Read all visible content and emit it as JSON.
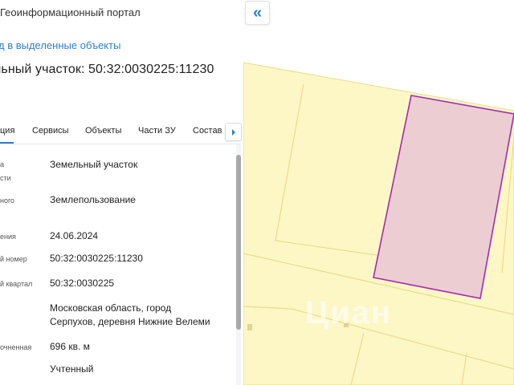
{
  "header": {
    "portal_title": "Геоинформационный портал",
    "back_link": "д в выделенные объекты"
  },
  "object": {
    "heading": "льный участок: 50:32:0030225:11230"
  },
  "tabs": [
    {
      "label": "ция",
      "active": true
    },
    {
      "label": "Сервисы",
      "active": false
    },
    {
      "label": "Объекты",
      "active": false
    },
    {
      "label": "Части ЗУ",
      "active": false
    },
    {
      "label": "Состав",
      "active": false
    }
  ],
  "info_rows": [
    {
      "label_line1": "а",
      "label_line2": "сти",
      "value_line1": "Земельный участок",
      "value_line2": ""
    },
    {
      "label_line1": "ного",
      "label_line2": "",
      "value_line1": "Землепользование",
      "value_line2": ""
    },
    {
      "label_line1": "ения",
      "label_line2": "",
      "value_line1": "24.06.2024",
      "value_line2": ""
    },
    {
      "label_line1": "й номер",
      "label_line2": "",
      "value_line1": "50:32:0030225:11230",
      "value_line2": ""
    },
    {
      "label_line1": "й квартал",
      "label_line2": "",
      "value_line1": "50:32:0030225",
      "value_line2": ""
    },
    {
      "label_line1": "",
      "label_line2": "",
      "value_line1": "Московская область, город",
      "value_line2": "Серпухов, деревня Нижние Велеми"
    },
    {
      "label_line1": "очненная",
      "label_line2": "",
      "value_line1": "696 кв. м",
      "value_line2": ""
    },
    {
      "label_line1": "",
      "label_line2": "",
      "value_line1": "Учтенный",
      "value_line2": ""
    }
  ],
  "map": {
    "collapse_icon": "double-chevron-left-icon",
    "watermark": "Циан",
    "colors": {
      "land": "#fdf7c6",
      "land_border": "#e8dc8a",
      "parcel_fill": "#ebcdd2",
      "parcel_border": "#a52ab1",
      "accent": "#2d7fd4"
    }
  }
}
